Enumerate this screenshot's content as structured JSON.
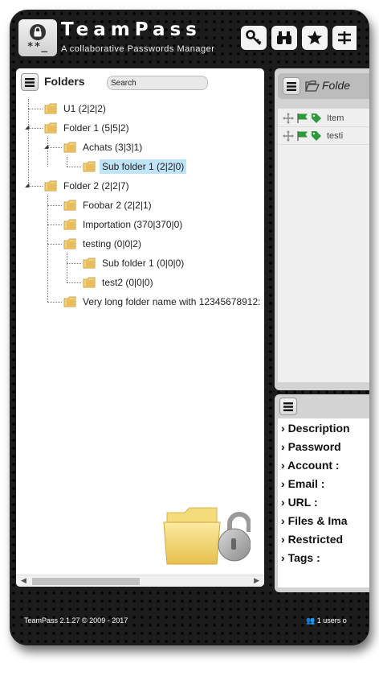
{
  "header": {
    "title": "TeamPass",
    "subtitle": "A collaborative Passwords Manager",
    "logo_text": "**_",
    "toolbar": [
      {
        "icon": "key-icon"
      },
      {
        "icon": "binoculars-icon"
      },
      {
        "icon": "star-icon"
      },
      {
        "icon": "sliders-icon"
      }
    ]
  },
  "folders_panel": {
    "title": "Folders",
    "search_placeholder": "Search",
    "tree": [
      {
        "label": "U1 (2|2|2)",
        "selected": false
      },
      {
        "label": "Folder 1 (5|5|2)",
        "selected": false
      },
      {
        "label": "Achats (3|3|1)",
        "selected": false
      },
      {
        "label": "Sub folder 1 (2|2|0)",
        "selected": true
      },
      {
        "label": "Folder 2 (2|2|7)",
        "selected": false
      },
      {
        "label": "Foobar 2 (2|2|1)",
        "selected": false
      },
      {
        "label": "Importation (370|370|0)",
        "selected": false
      },
      {
        "label": "testing (0|0|2)",
        "selected": false
      },
      {
        "label": "Sub folder 1 (0|0|0)",
        "selected": false
      },
      {
        "label": "test2 (0|0|0)",
        "selected": false
      },
      {
        "label": "Very long folder name with 12345678912:",
        "selected": false
      }
    ]
  },
  "items_panel": {
    "header_label": "Folde",
    "items": [
      {
        "label": "Item"
      },
      {
        "label": "testi"
      }
    ]
  },
  "details_panel": {
    "fields": [
      {
        "label": "Description"
      },
      {
        "label": "Password"
      },
      {
        "label": "Account :"
      },
      {
        "label": "Email :"
      },
      {
        "label": "URL :"
      },
      {
        "label": "Files & Ima"
      },
      {
        "label": "Restricted"
      },
      {
        "label": "Tags :"
      }
    ]
  },
  "footer": {
    "version": "TeamPass 2.1.27 © 2009 - 2017",
    "users": "1 users o"
  },
  "colors": {
    "selected_bg": "#bfe3f7",
    "folder_yellow": "#f3d27a",
    "tag_green": "#2e9a3e"
  }
}
